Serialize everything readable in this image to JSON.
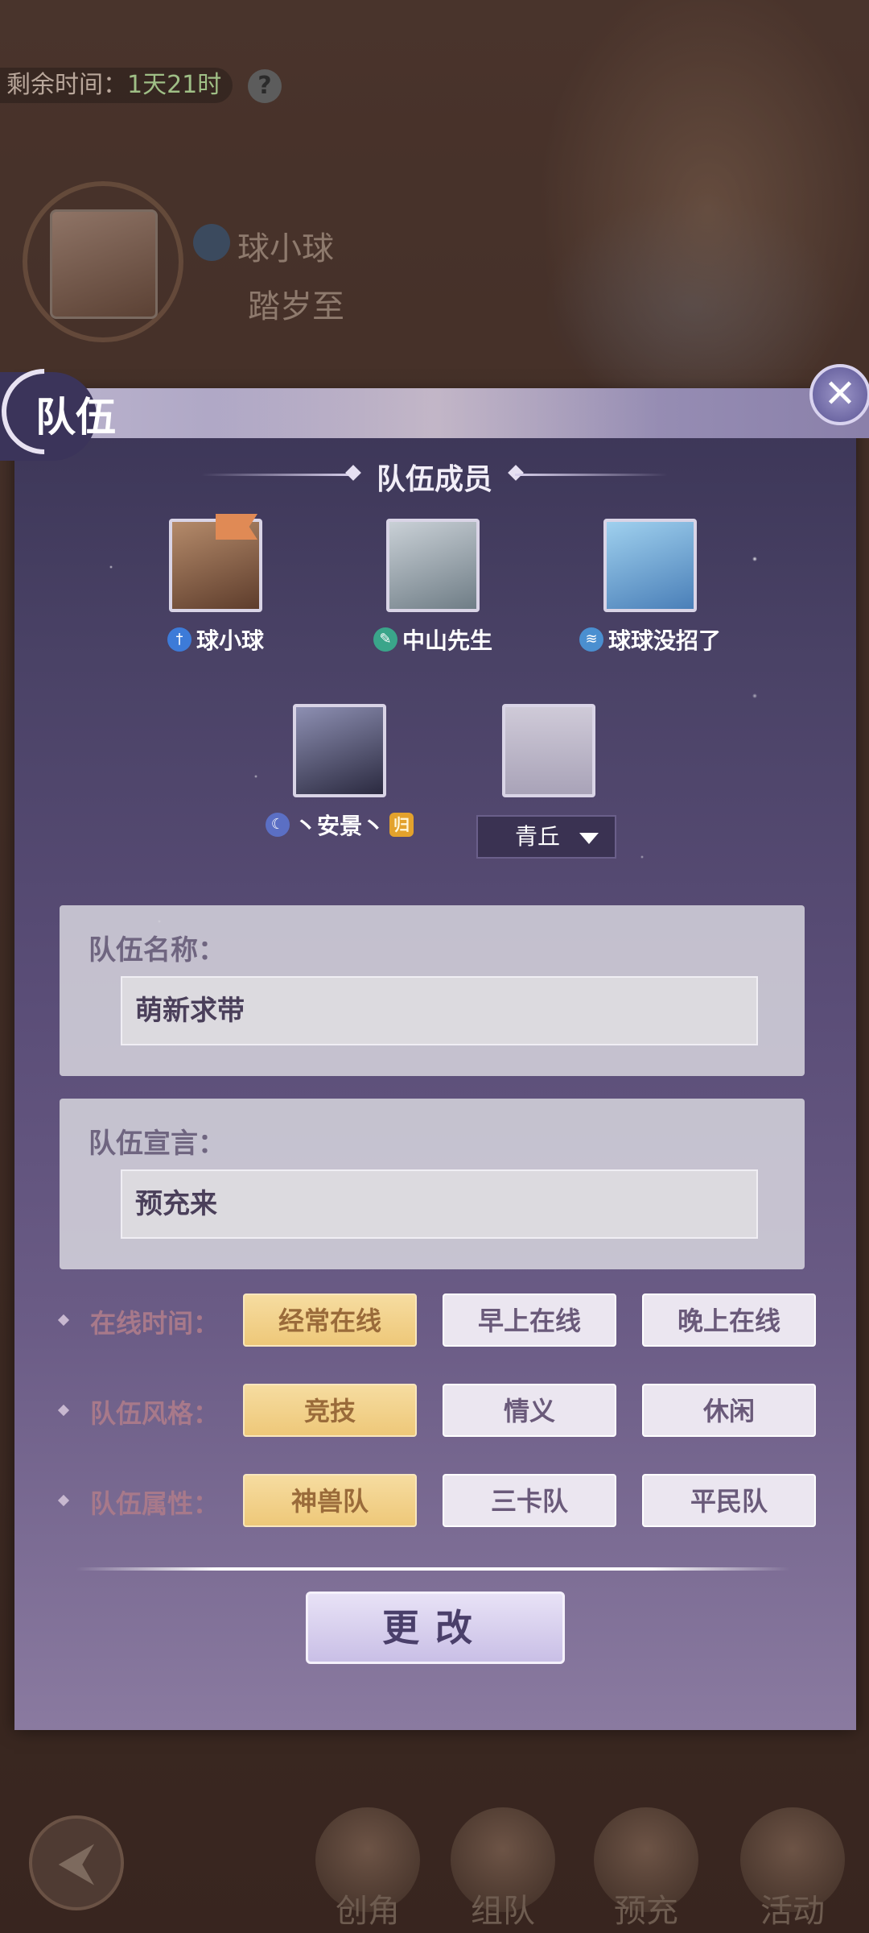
{
  "background": {
    "timer": {
      "label": "剩余时间：",
      "value": "1天21时"
    },
    "profile": {
      "name": "球小球",
      "server": "踏岁至"
    },
    "bottom_nav": [
      {
        "label": "创角"
      },
      {
        "label": "组队"
      },
      {
        "label": "预充"
      },
      {
        "label": "活动"
      }
    ]
  },
  "panel": {
    "title": "队伍",
    "section_title": "队伍成员",
    "members": [
      {
        "name": "球小球",
        "badge_color": "#3d7bd8",
        "portrait_colors": [
          "#b48a6a",
          "#5e3d2c"
        ]
      },
      {
        "name": "中山先生",
        "badge_color": "#3aa58a",
        "portrait_colors": [
          "#c9d0d6",
          "#6f7d86"
        ]
      },
      {
        "name": "球球没招了",
        "badge_color": "#4a8fd0",
        "portrait_colors": [
          "#9fd0ee",
          "#4a7fb8"
        ]
      },
      {
        "name": "丶安景丶",
        "badge_color": "#5b6fc4",
        "portrait_colors": [
          "#8d8fb2",
          "#2b2a40"
        ],
        "tag": "归"
      }
    ],
    "empty_slot": {
      "server_select": "青丘"
    },
    "team_name": {
      "label": "队伍名称：",
      "value": "萌新求带"
    },
    "team_declaration": {
      "label": "队伍宣言：",
      "value": "预充来"
    },
    "options": [
      {
        "label": "在线时间：",
        "choices": [
          "经常在线",
          "早上在线",
          "晚上在线"
        ],
        "selected": 0
      },
      {
        "label": "队伍风格：",
        "choices": [
          "竞技",
          "情义",
          "休闲"
        ],
        "selected": 0
      },
      {
        "label": "队伍属性：",
        "choices": [
          "神兽队",
          "三卡队",
          "平民队"
        ],
        "selected": 0
      }
    ],
    "modify_button": "更改"
  }
}
